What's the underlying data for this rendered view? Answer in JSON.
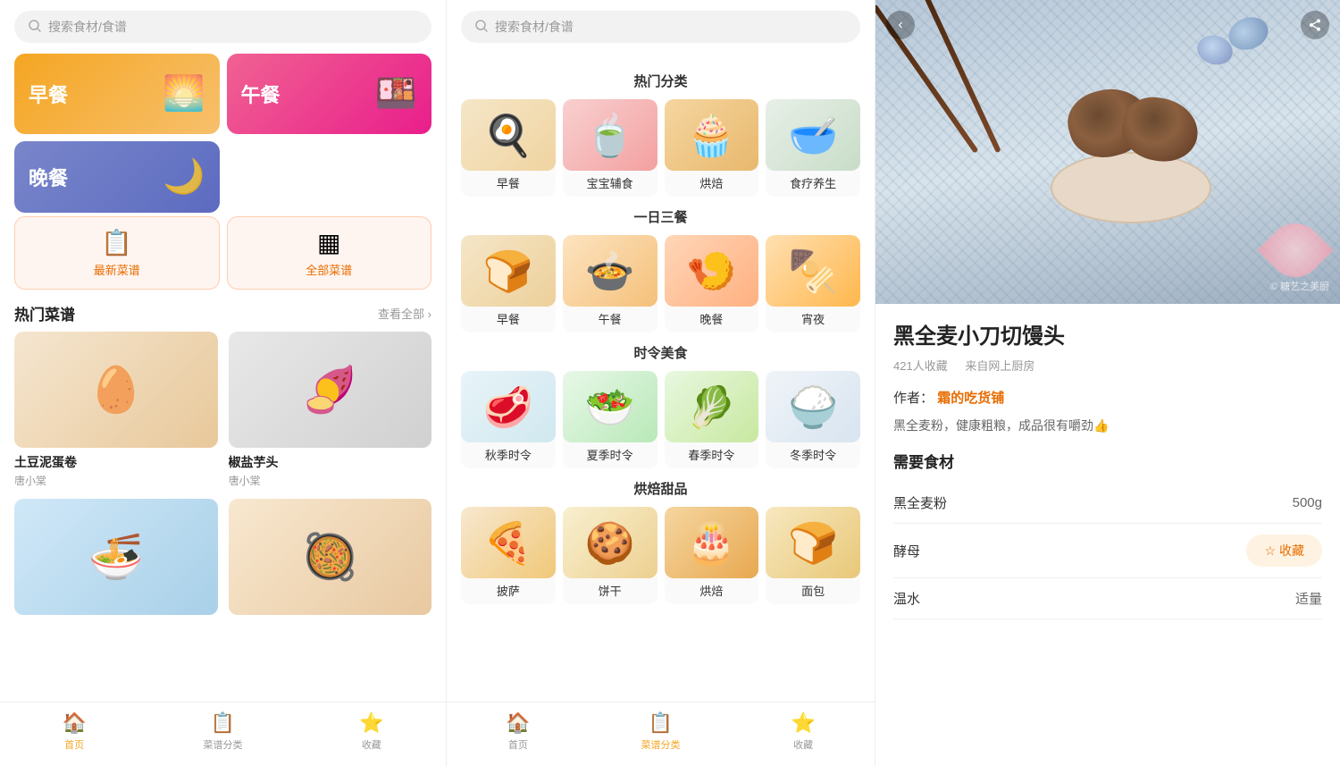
{
  "panel1": {
    "search": {
      "placeholder": "搜索食材/食谱",
      "icon": "search"
    },
    "meals": [
      {
        "id": "breakfast",
        "label": "早餐",
        "emoji": "🌅",
        "class": "breakfast"
      },
      {
        "id": "lunch",
        "label": "午餐",
        "emoji": "🍱",
        "class": "lunch"
      },
      {
        "id": "dinner",
        "label": "晚餐",
        "emoji": "🌙",
        "class": "dinner"
      }
    ],
    "actions": [
      {
        "id": "new-recipes",
        "icon": "📋",
        "label": "最新菜谱"
      },
      {
        "id": "all-recipes",
        "icon": "▦",
        "label": "全部菜谱"
      }
    ],
    "hot_section": {
      "title": "热门菜谱",
      "see_all": "查看全部 ›"
    },
    "recipes": [
      {
        "id": 1,
        "name": "土豆泥蛋卷",
        "author": "唐小棠",
        "bg": "recipe-img1"
      },
      {
        "id": 2,
        "name": "椒盐芋头",
        "author": "唐小棠",
        "bg": "recipe-img2"
      },
      {
        "id": 3,
        "name": "",
        "author": "",
        "bg": "recipe-img3"
      },
      {
        "id": 4,
        "name": "",
        "author": "",
        "bg": "recipe-img4"
      }
    ],
    "nav": [
      {
        "id": "home",
        "icon": "🏠",
        "label": "首页",
        "active": true
      },
      {
        "id": "category",
        "icon": "📋",
        "label": "菜谱分类",
        "active": false
      },
      {
        "id": "collect",
        "icon": "⭐",
        "label": "收藏",
        "active": false
      }
    ]
  },
  "panel2": {
    "search": {
      "placeholder": "搜索食材/食谱"
    },
    "sections": [
      {
        "title": "热门分类",
        "items": [
          {
            "id": "zaochan",
            "label": "早餐",
            "emoji": "🍳",
            "bg_class": "food-zaochan"
          },
          {
            "id": "baobao",
            "label": "宝宝辅食",
            "emoji": "🍵",
            "bg_class": "food-baobao"
          },
          {
            "id": "hongbei",
            "label": "烘焙",
            "emoji": "🧁",
            "bg_class": "food-hongbei"
          },
          {
            "id": "shiliao",
            "label": "食疗养生",
            "emoji": "🥣",
            "bg_class": "food-shiliao"
          }
        ]
      },
      {
        "title": "一日三餐",
        "items": [
          {
            "id": "zaochan2",
            "label": "早餐",
            "emoji": "🍞",
            "bg_class": "food-zaochan2"
          },
          {
            "id": "wucan",
            "label": "午餐",
            "emoji": "🍲",
            "bg_class": "food-wucan"
          },
          {
            "id": "wancan",
            "label": "晚餐",
            "emoji": "🍤",
            "bg_class": "food-wancan"
          },
          {
            "id": "suye",
            "label": "宵夜",
            "emoji": "🍢",
            "bg_class": "food-suye"
          }
        ]
      },
      {
        "title": "时令美食",
        "items": [
          {
            "id": "qiuji",
            "label": "秋季时令",
            "emoji": "🥩",
            "bg_class": "food-qiuji"
          },
          {
            "id": "xiaji",
            "label": "夏季时令",
            "emoji": "🥗",
            "bg_class": "food-xiaji"
          },
          {
            "id": "chunji",
            "label": "春季时令",
            "emoji": "🥬",
            "bg_class": "food-chunji"
          },
          {
            "id": "dongji",
            "label": "冬季时令",
            "emoji": "🍚",
            "bg_class": "food-dongji"
          }
        ]
      },
      {
        "title": "烘焙甜品",
        "items": [
          {
            "id": "pizza",
            "label": "披萨",
            "emoji": "🍕",
            "bg_class": "food-pizza"
          },
          {
            "id": "binggan",
            "label": "饼干",
            "emoji": "🍪",
            "bg_class": "food-binggan"
          },
          {
            "id": "hongbei2",
            "label": "烘焙",
            "emoji": "🎂",
            "bg_class": "food-hongbei2"
          },
          {
            "id": "mianbao",
            "label": "面包",
            "emoji": "🍞",
            "bg_class": "food-mianbao"
          }
        ]
      }
    ],
    "nav": [
      {
        "id": "home",
        "icon": "🏠",
        "label": "首页",
        "active": false
      },
      {
        "id": "category",
        "icon": "📋",
        "label": "菜谱分类",
        "active": true
      },
      {
        "id": "collect",
        "icon": "⭐",
        "label": "收藏",
        "active": false
      }
    ]
  },
  "panel3": {
    "back_btn": "‹",
    "share_icon": "📤",
    "watermark": "© 糖艺之美厨",
    "recipe": {
      "title": "黑全麦小刀切馒头",
      "saves": "421人收藏",
      "source": "来自网上厨房",
      "author_prefix": "作者：",
      "author": "霜的吃货铺",
      "description": "黑全麦粉，健康粗粮，成品很有嚼劲👍",
      "ingredients_title": "需要食材",
      "ingredients": [
        {
          "name": "黑全麦粉",
          "amount": "500g",
          "has_collect": false
        },
        {
          "name": "酵母",
          "amount": "",
          "has_collect": true
        },
        {
          "name": "温水",
          "amount": "适量",
          "has_collect": false
        }
      ],
      "collect_btn": "收藏"
    }
  }
}
